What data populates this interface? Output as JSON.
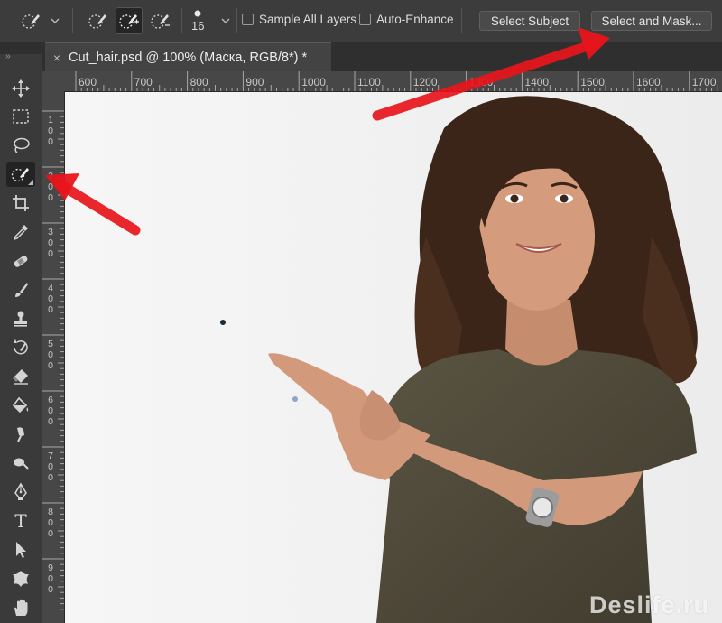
{
  "options_bar": {
    "brush_size": "16",
    "sample_all_layers": {
      "label": "Sample All Layers",
      "checked": false
    },
    "auto_enhance": {
      "label": "Auto-Enhance",
      "checked": false
    },
    "select_subject_label": "Select Subject",
    "select_and_mask_label": "Select and Mask..."
  },
  "document_tab": {
    "close_glyph": "×",
    "title": "Cut_hair.psd @ 100% (Маска, RGB/8*) *"
  },
  "toolbar": {
    "collapse_glyph": "››",
    "tools": [
      {
        "name": "move-tool",
        "icon": "move-icon",
        "active": false
      },
      {
        "name": "marquee-tool",
        "icon": "rect-marquee-icon",
        "active": false
      },
      {
        "name": "lasso-tool",
        "icon": "lasso-icon",
        "active": false
      },
      {
        "name": "quick-selection-tool",
        "icon": "quick-selection-icon",
        "active": true
      },
      {
        "name": "crop-tool",
        "icon": "crop-icon",
        "active": false
      },
      {
        "name": "eyedropper-tool",
        "icon": "eyedropper-icon",
        "active": false
      },
      {
        "name": "healing-tool",
        "icon": "bandage-icon",
        "active": false
      },
      {
        "name": "brush-tool",
        "icon": "brush-icon",
        "active": false
      },
      {
        "name": "stamp-tool",
        "icon": "stamp-icon",
        "active": false
      },
      {
        "name": "history-brush-tool",
        "icon": "history-brush-icon",
        "active": false
      },
      {
        "name": "eraser-tool",
        "icon": "eraser-icon",
        "active": false
      },
      {
        "name": "paint-bucket-tool",
        "icon": "paint-bucket-icon",
        "active": false
      },
      {
        "name": "smudge-tool",
        "icon": "smudge-icon",
        "active": false
      },
      {
        "name": "dodge-tool",
        "icon": "dodge-icon",
        "active": false
      },
      {
        "name": "pen-tool",
        "icon": "pen-icon",
        "active": false
      },
      {
        "name": "type-tool",
        "icon": "type-icon",
        "active": false
      },
      {
        "name": "path-selection-tool",
        "icon": "arrow-icon",
        "active": false
      },
      {
        "name": "custom-shape-tool",
        "icon": "shape-icon",
        "active": false
      },
      {
        "name": "hand-tool",
        "icon": "hand-icon",
        "active": false
      }
    ],
    "type_glyph": "T"
  },
  "ruler_h": [
    "600",
    "700",
    "800",
    "900",
    "1000",
    "1100",
    "1200",
    "1300",
    "1400",
    "1500",
    "1600",
    "1700"
  ],
  "ruler_v": [
    [
      "1",
      "0",
      "0"
    ],
    [
      "2",
      "0",
      "0"
    ],
    [
      "3",
      "0",
      "0"
    ],
    [
      "4",
      "0",
      "0"
    ],
    [
      "5",
      "0",
      "0"
    ],
    [
      "6",
      "0",
      "0"
    ],
    [
      "7",
      "0",
      "0"
    ],
    [
      "8",
      "0",
      "0"
    ],
    [
      "9",
      "0",
      "0"
    ]
  ],
  "watermark": "Deslife.ru",
  "colors": {
    "annotation_arrow": "#e8151b",
    "canvas": "#f3f3f3",
    "panel": "#3c3c3c"
  }
}
